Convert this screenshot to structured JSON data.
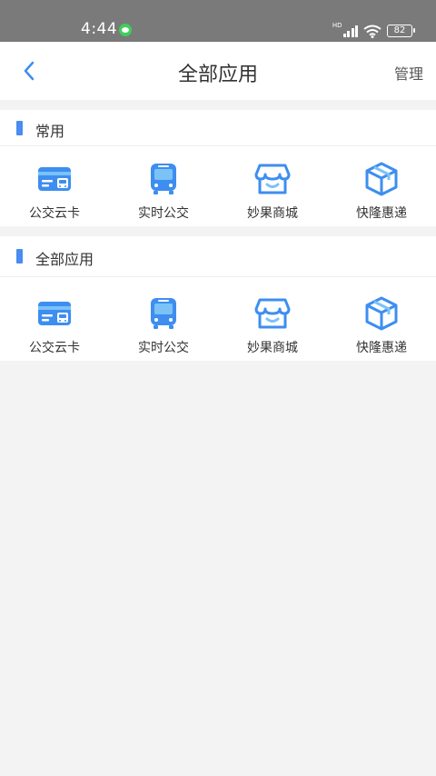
{
  "status_bar": {
    "time": "4:44",
    "hd": "HD",
    "battery": "82"
  },
  "nav": {
    "title": "全部应用",
    "manage_label": "管理"
  },
  "colors": {
    "accent": "#4a8cf0",
    "icon_blue": "#3d8ef0",
    "icon_light": "#7bc2f7"
  },
  "sections": [
    {
      "title": "常用",
      "apps": [
        {
          "label": "公交云卡",
          "icon": "bus-card-icon"
        },
        {
          "label": "实时公交",
          "icon": "bus-icon"
        },
        {
          "label": "妙果商城",
          "icon": "shop-icon"
        },
        {
          "label": "快隆惠递",
          "icon": "package-icon"
        }
      ]
    },
    {
      "title": "全部应用",
      "apps": [
        {
          "label": "公交云卡",
          "icon": "bus-card-icon"
        },
        {
          "label": "实时公交",
          "icon": "bus-icon"
        },
        {
          "label": "妙果商城",
          "icon": "shop-icon"
        },
        {
          "label": "快隆惠递",
          "icon": "package-icon"
        }
      ]
    }
  ]
}
